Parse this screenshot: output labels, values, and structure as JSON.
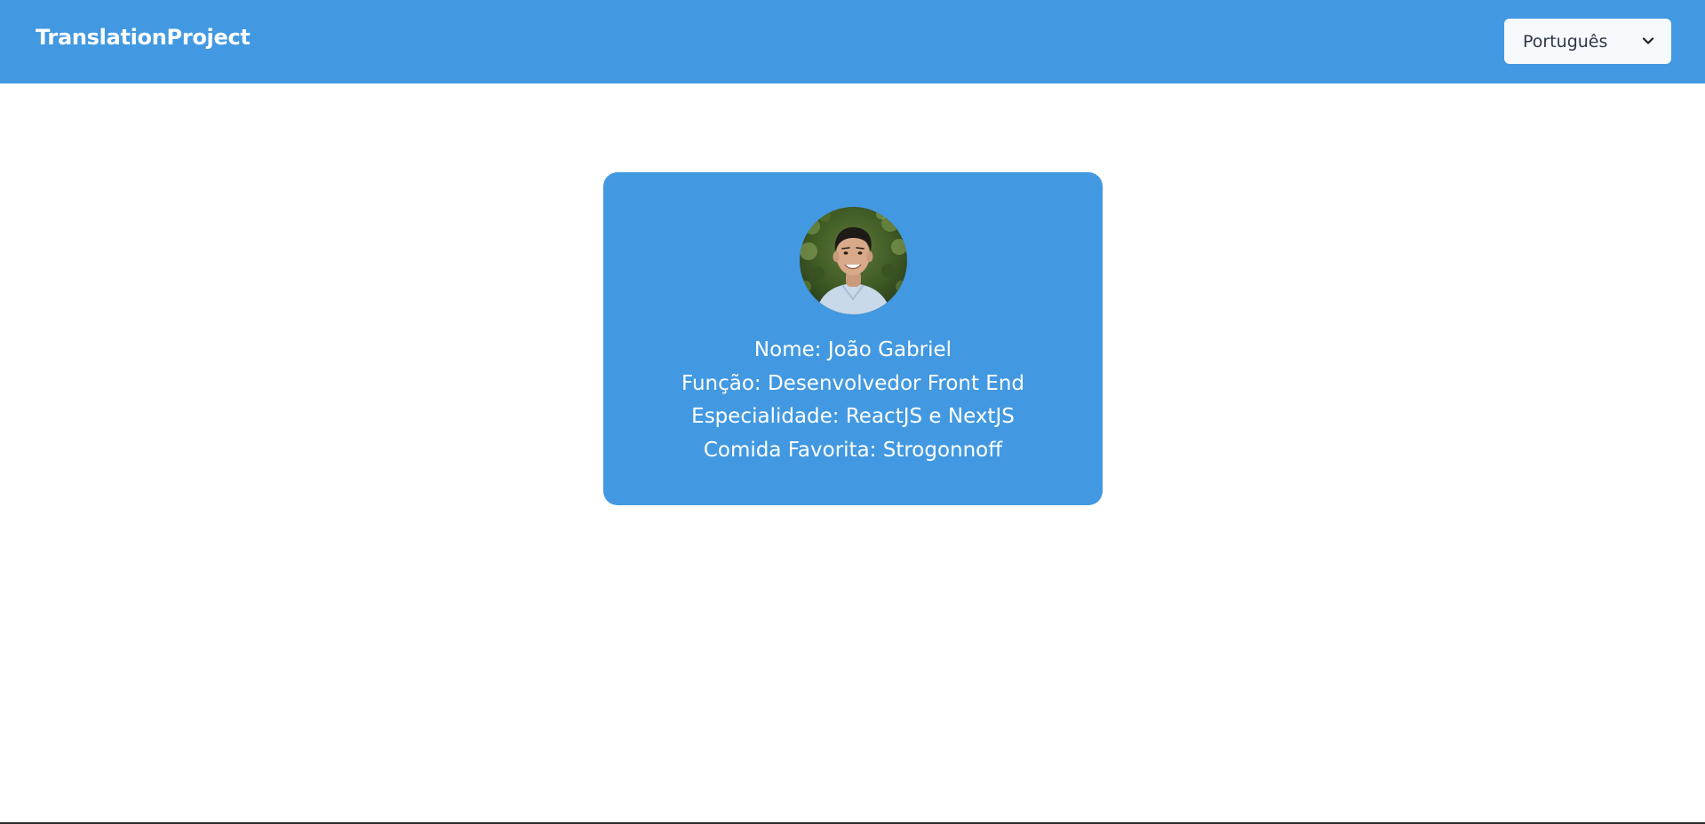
{
  "header": {
    "brand": "TranslationProject",
    "language_select": {
      "selected": "Português",
      "icon": "chevron-down-icon"
    }
  },
  "profile": {
    "photo_alt": "profile photo",
    "name_line": "Nome: João Gabriel",
    "role_line": "Função: Desenvolvedor Front End",
    "specialty_line": "Especialidade: ReactJS e NextJS",
    "food_line": "Comida Favorita: Strogonnoff"
  },
  "colors": {
    "primary": "#4299e1",
    "select_bg": "#f7fafc",
    "text_light": "#ffffff",
    "text_dark": "#2d3748"
  }
}
